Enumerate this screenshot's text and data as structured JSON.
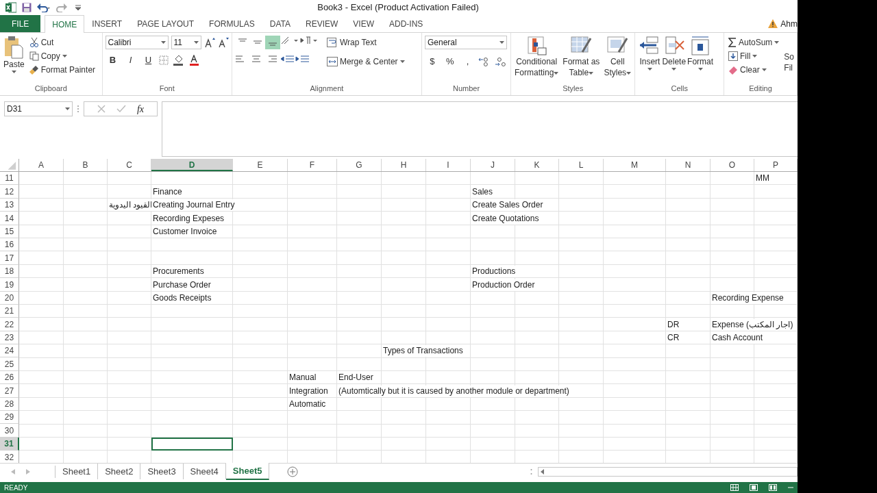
{
  "title_bar": {
    "title": "Book3 - Excel (Product Activation Failed)"
  },
  "ribbon_tabs": [
    {
      "label": "FILE",
      "kind": "file",
      "selected": false
    },
    {
      "label": "HOME",
      "kind": "tab",
      "selected": true
    },
    {
      "label": "INSERT",
      "kind": "tab",
      "selected": false
    },
    {
      "label": "PAGE LAYOUT",
      "kind": "tab",
      "selected": false
    },
    {
      "label": "FORMULAS",
      "kind": "tab",
      "selected": false
    },
    {
      "label": "DATA",
      "kind": "tab",
      "selected": false
    },
    {
      "label": "REVIEW",
      "kind": "tab",
      "selected": false
    },
    {
      "label": "VIEW",
      "kind": "tab",
      "selected": false
    },
    {
      "label": "ADD-INS",
      "kind": "tab",
      "selected": false
    }
  ],
  "account": {
    "name": "Ahm"
  },
  "clipboard": {
    "label": "Clipboard",
    "paste": "Paste",
    "cut": "Cut",
    "copy": "Copy",
    "format_painter": "Format Painter"
  },
  "font": {
    "label": "Font",
    "font_name": "Calibri",
    "font_size": "11",
    "style_buttons": [
      "B",
      "I",
      "U"
    ]
  },
  "alignment": {
    "label": "Alignment",
    "vertical_align": [
      {
        "selected": false
      },
      {
        "selected": false
      },
      {
        "selected": true
      }
    ],
    "wrap_text": "Wrap Text",
    "merge_center": "Merge & Center"
  },
  "number": {
    "label": "Number",
    "format": "General",
    "symbols": [
      "$",
      "%",
      ","
    ]
  },
  "styles": {
    "label": "Styles",
    "buttons": [
      {
        "lines": [
          "Conditional",
          "Formatting"
        ]
      },
      {
        "lines": [
          "Format as",
          "Table"
        ]
      },
      {
        "lines": [
          "Cell",
          "Styles"
        ]
      }
    ]
  },
  "cells": {
    "label": "Cells",
    "buttons": [
      "Insert",
      "Delete",
      "Format"
    ]
  },
  "editing": {
    "label": "Editing",
    "autosum": "AutoSum",
    "fill": "Fill",
    "clear": "Clear",
    "sort_lines": [
      "So",
      "Fil"
    ]
  },
  "formula_bar": {
    "name_box": "D31",
    "fx": "fx"
  },
  "columns": [
    {
      "label": "A",
      "selected": false
    },
    {
      "label": "B",
      "selected": false
    },
    {
      "label": "C",
      "selected": false
    },
    {
      "label": "D",
      "selected": true
    },
    {
      "label": "E",
      "selected": false
    },
    {
      "label": "F",
      "selected": false
    },
    {
      "label": "G",
      "selected": false
    },
    {
      "label": "H",
      "selected": false
    },
    {
      "label": "I",
      "selected": false
    },
    {
      "label": "J",
      "selected": false
    },
    {
      "label": "K",
      "selected": false
    },
    {
      "label": "L",
      "selected": false
    },
    {
      "label": "M",
      "selected": false
    },
    {
      "label": "N",
      "selected": false
    },
    {
      "label": "O",
      "selected": false
    },
    {
      "label": "P",
      "selected": false
    }
  ],
  "rows": [
    {
      "number": "11",
      "selected": false,
      "cells": {
        "P": "MM"
      }
    },
    {
      "number": "12",
      "selected": false,
      "cells": {
        "D": "Finance",
        "J": "Sales"
      }
    },
    {
      "number": "13",
      "selected": false,
      "cells": {
        "C": "القيود اليدوية",
        "D": "Creating Journal Entry",
        "J": "Create Sales Order"
      }
    },
    {
      "number": "14",
      "selected": false,
      "cells": {
        "D": "Recording Expeses",
        "J": "Create Quotations"
      }
    },
    {
      "number": "15",
      "selected": false,
      "cells": {
        "D": "Customer Invoice"
      }
    },
    {
      "number": "16",
      "selected": false
    },
    {
      "number": "17",
      "selected": false
    },
    {
      "number": "18",
      "selected": false,
      "cells": {
        "D": "Procurements",
        "J": "Productions"
      }
    },
    {
      "number": "19",
      "selected": false,
      "cells": {
        "D": "Purchase Order",
        "J": "Production Order"
      }
    },
    {
      "number": "20",
      "selected": false,
      "cells": {
        "D": "Goods Receipts",
        "O": "Recording Expense"
      }
    },
    {
      "number": "21",
      "selected": false
    },
    {
      "number": "22",
      "selected": false,
      "cells": {
        "N": "DR",
        "O": "Expense (اجار المكتب)"
      }
    },
    {
      "number": "23",
      "selected": false,
      "cells": {
        "N": "CR",
        "O": "Cash Account"
      }
    },
    {
      "number": "24",
      "selected": false,
      "cells": {
        "H": "Types of Transactions"
      }
    },
    {
      "number": "25",
      "selected": false
    },
    {
      "number": "26",
      "selected": false,
      "cells": {
        "F": "Manual",
        "G": "End-User"
      }
    },
    {
      "number": "27",
      "selected": false,
      "cells": {
        "F": "Integration",
        "G": "(Automtically but it is caused by another module or department)"
      }
    },
    {
      "number": "28",
      "selected": false,
      "cells": {
        "F": "Automatic"
      }
    },
    {
      "number": "29",
      "selected": false
    },
    {
      "number": "30",
      "selected": false
    },
    {
      "number": "31",
      "selected": true
    },
    {
      "number": "32",
      "selected": false
    }
  ],
  "sheet_tabs": [
    {
      "label": "Sheet1",
      "selected": false
    },
    {
      "label": "Sheet2",
      "selected": false
    },
    {
      "label": "Sheet3",
      "selected": false
    },
    {
      "label": "Sheet4",
      "selected": false
    },
    {
      "label": "Sheet5",
      "selected": true
    }
  ],
  "status_bar": {
    "text": "READY"
  }
}
